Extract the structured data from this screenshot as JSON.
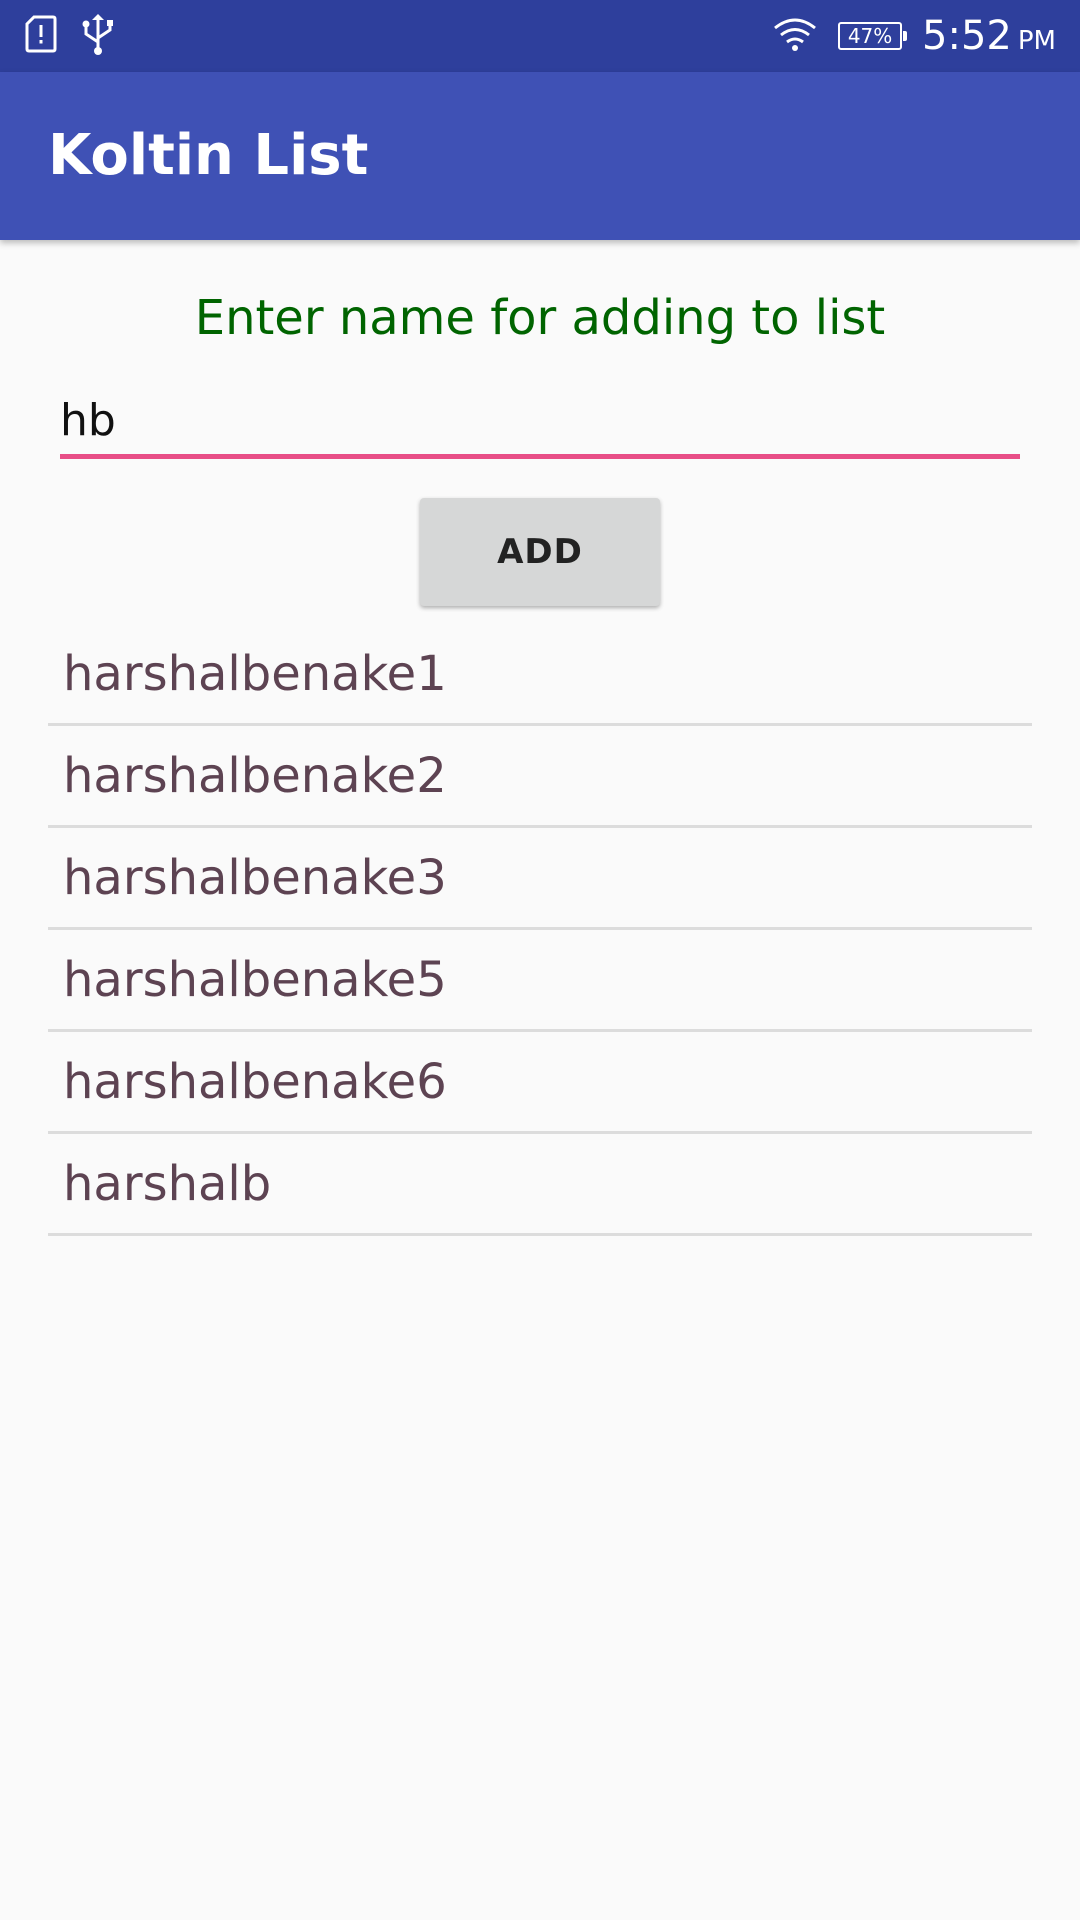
{
  "status_bar": {
    "left_icons": [
      "sd-card-alert-icon",
      "usb-icon"
    ],
    "wifi_icon": "wifi-icon",
    "battery_percent": "47%",
    "time": "5:52",
    "ampm": "PM"
  },
  "app_bar": {
    "title": "Koltin List"
  },
  "form": {
    "prompt": "Enter name for adding to list",
    "input_value": "hb",
    "add_button_label": "ADD"
  },
  "list": {
    "items": [
      "harshalbenake1",
      "harshalbenake2",
      "harshalbenake3",
      "harshalbenake5",
      "harshalbenake6",
      "harshalb"
    ]
  },
  "colors": {
    "status_bar": "#2e3f9c",
    "app_bar": "#3f51b5",
    "prompt_text": "#006400",
    "input_underline": "#e84e87",
    "list_text": "#5d4352"
  }
}
